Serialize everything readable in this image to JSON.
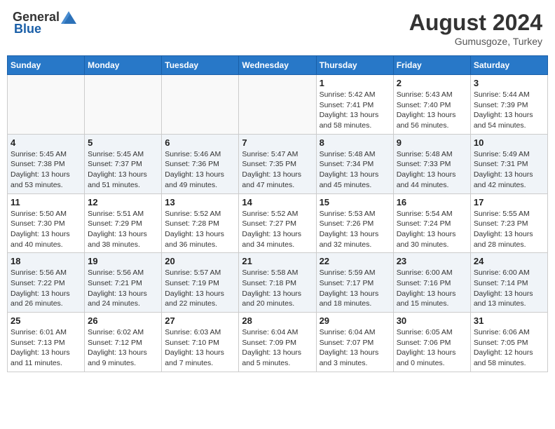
{
  "header": {
    "logo_general": "General",
    "logo_blue": "Blue",
    "month_year": "August 2024",
    "location": "Gumusgoze, Turkey"
  },
  "days_of_week": [
    "Sunday",
    "Monday",
    "Tuesday",
    "Wednesday",
    "Thursday",
    "Friday",
    "Saturday"
  ],
  "weeks": [
    {
      "days": [
        {
          "number": "",
          "info": ""
        },
        {
          "number": "",
          "info": ""
        },
        {
          "number": "",
          "info": ""
        },
        {
          "number": "",
          "info": ""
        },
        {
          "number": "1",
          "info": "Sunrise: 5:42 AM\nSunset: 7:41 PM\nDaylight: 13 hours and 58 minutes."
        },
        {
          "number": "2",
          "info": "Sunrise: 5:43 AM\nSunset: 7:40 PM\nDaylight: 13 hours and 56 minutes."
        },
        {
          "number": "3",
          "info": "Sunrise: 5:44 AM\nSunset: 7:39 PM\nDaylight: 13 hours and 54 minutes."
        }
      ]
    },
    {
      "days": [
        {
          "number": "4",
          "info": "Sunrise: 5:45 AM\nSunset: 7:38 PM\nDaylight: 13 hours and 53 minutes."
        },
        {
          "number": "5",
          "info": "Sunrise: 5:45 AM\nSunset: 7:37 PM\nDaylight: 13 hours and 51 minutes."
        },
        {
          "number": "6",
          "info": "Sunrise: 5:46 AM\nSunset: 7:36 PM\nDaylight: 13 hours and 49 minutes."
        },
        {
          "number": "7",
          "info": "Sunrise: 5:47 AM\nSunset: 7:35 PM\nDaylight: 13 hours and 47 minutes."
        },
        {
          "number": "8",
          "info": "Sunrise: 5:48 AM\nSunset: 7:34 PM\nDaylight: 13 hours and 45 minutes."
        },
        {
          "number": "9",
          "info": "Sunrise: 5:48 AM\nSunset: 7:33 PM\nDaylight: 13 hours and 44 minutes."
        },
        {
          "number": "10",
          "info": "Sunrise: 5:49 AM\nSunset: 7:31 PM\nDaylight: 13 hours and 42 minutes."
        }
      ]
    },
    {
      "days": [
        {
          "number": "11",
          "info": "Sunrise: 5:50 AM\nSunset: 7:30 PM\nDaylight: 13 hours and 40 minutes."
        },
        {
          "number": "12",
          "info": "Sunrise: 5:51 AM\nSunset: 7:29 PM\nDaylight: 13 hours and 38 minutes."
        },
        {
          "number": "13",
          "info": "Sunrise: 5:52 AM\nSunset: 7:28 PM\nDaylight: 13 hours and 36 minutes."
        },
        {
          "number": "14",
          "info": "Sunrise: 5:52 AM\nSunset: 7:27 PM\nDaylight: 13 hours and 34 minutes."
        },
        {
          "number": "15",
          "info": "Sunrise: 5:53 AM\nSunset: 7:26 PM\nDaylight: 13 hours and 32 minutes."
        },
        {
          "number": "16",
          "info": "Sunrise: 5:54 AM\nSunset: 7:24 PM\nDaylight: 13 hours and 30 minutes."
        },
        {
          "number": "17",
          "info": "Sunrise: 5:55 AM\nSunset: 7:23 PM\nDaylight: 13 hours and 28 minutes."
        }
      ]
    },
    {
      "days": [
        {
          "number": "18",
          "info": "Sunrise: 5:56 AM\nSunset: 7:22 PM\nDaylight: 13 hours and 26 minutes."
        },
        {
          "number": "19",
          "info": "Sunrise: 5:56 AM\nSunset: 7:21 PM\nDaylight: 13 hours and 24 minutes."
        },
        {
          "number": "20",
          "info": "Sunrise: 5:57 AM\nSunset: 7:19 PM\nDaylight: 13 hours and 22 minutes."
        },
        {
          "number": "21",
          "info": "Sunrise: 5:58 AM\nSunset: 7:18 PM\nDaylight: 13 hours and 20 minutes."
        },
        {
          "number": "22",
          "info": "Sunrise: 5:59 AM\nSunset: 7:17 PM\nDaylight: 13 hours and 18 minutes."
        },
        {
          "number": "23",
          "info": "Sunrise: 6:00 AM\nSunset: 7:16 PM\nDaylight: 13 hours and 15 minutes."
        },
        {
          "number": "24",
          "info": "Sunrise: 6:00 AM\nSunset: 7:14 PM\nDaylight: 13 hours and 13 minutes."
        }
      ]
    },
    {
      "days": [
        {
          "number": "25",
          "info": "Sunrise: 6:01 AM\nSunset: 7:13 PM\nDaylight: 13 hours and 11 minutes."
        },
        {
          "number": "26",
          "info": "Sunrise: 6:02 AM\nSunset: 7:12 PM\nDaylight: 13 hours and 9 minutes."
        },
        {
          "number": "27",
          "info": "Sunrise: 6:03 AM\nSunset: 7:10 PM\nDaylight: 13 hours and 7 minutes."
        },
        {
          "number": "28",
          "info": "Sunrise: 6:04 AM\nSunset: 7:09 PM\nDaylight: 13 hours and 5 minutes."
        },
        {
          "number": "29",
          "info": "Sunrise: 6:04 AM\nSunset: 7:07 PM\nDaylight: 13 hours and 3 minutes."
        },
        {
          "number": "30",
          "info": "Sunrise: 6:05 AM\nSunset: 7:06 PM\nDaylight: 13 hours and 0 minutes."
        },
        {
          "number": "31",
          "info": "Sunrise: 6:06 AM\nSunset: 7:05 PM\nDaylight: 12 hours and 58 minutes."
        }
      ]
    }
  ]
}
